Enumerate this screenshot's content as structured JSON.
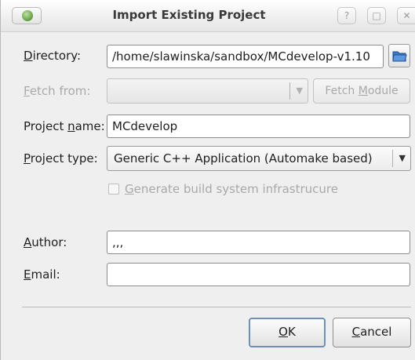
{
  "window": {
    "title": "Import Existing Project",
    "controls": {
      "help": "?",
      "maximize": "□",
      "close": "✕"
    }
  },
  "form": {
    "directory": {
      "label_prefix": "",
      "label_mnemonic": "D",
      "label_rest": "irectory:",
      "value": "/home/slawinska/sandbox/MCdevelop-v1.10",
      "browse_icon": "folder-open-icon"
    },
    "fetch_from": {
      "label_mnemonic": "F",
      "label_rest": "etch from:",
      "value": "",
      "button_prefix": "Fetch ",
      "button_mnemonic": "M",
      "button_rest": "odule"
    },
    "project_name": {
      "label_prefix": "Project ",
      "label_mnemonic": "n",
      "label_rest": "ame:",
      "value": "MCdevelop"
    },
    "project_type": {
      "label_mnemonic": "P",
      "label_rest": "roject type:",
      "value": "Generic C++ Application (Automake based)"
    },
    "generate_build_system": {
      "label_mnemonic": "G",
      "label_rest": "enerate build system infrastrucure",
      "checked": false
    },
    "author": {
      "label_mnemonic": "A",
      "label_rest": "uthor:",
      "value": ",,,"
    },
    "email": {
      "label_mnemonic": "E",
      "label_rest": "mail:",
      "value": ""
    }
  },
  "buttons": {
    "ok_mnemonic": "O",
    "ok_rest": "K",
    "cancel_mnemonic": "C",
    "cancel_rest": "ancel"
  },
  "colors": {
    "accent": "#6d8fb8",
    "disabled_text": "#a9a9a9"
  }
}
